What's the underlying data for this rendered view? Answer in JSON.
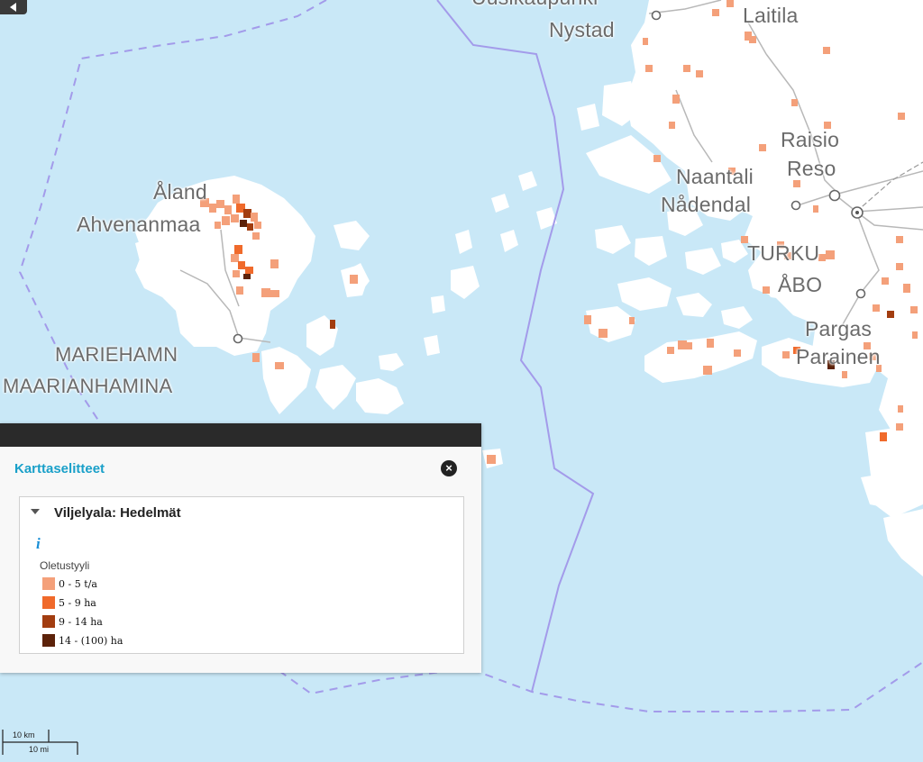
{
  "map": {
    "place_labels": [
      {
        "id": "uusikaupunki",
        "text": "Uusikaupunki"
      },
      {
        "id": "nystad",
        "text": "Nystad"
      },
      {
        "id": "laitila",
        "text": "Laitila"
      },
      {
        "id": "raisio",
        "text": "Raisio"
      },
      {
        "id": "reso",
        "text": "Reso"
      },
      {
        "id": "naantali",
        "text": "Naantali"
      },
      {
        "id": "nadendal",
        "text": "Nådendal"
      },
      {
        "id": "turku",
        "text": "TURKU"
      },
      {
        "id": "abo",
        "text": "ÅBO"
      },
      {
        "id": "pargas",
        "text": "Pargas"
      },
      {
        "id": "parainen",
        "text": "Parainen"
      },
      {
        "id": "aland",
        "text": "Åland"
      },
      {
        "id": "ahvenanmaa",
        "text": "Ahvenanmaa"
      },
      {
        "id": "mariehamn",
        "text": "MARIEHAMN"
      },
      {
        "id": "maarianhamina",
        "text": "MAARIANHAMINA"
      }
    ],
    "colors": {
      "water": "#c9e8f7",
      "land": "#ffffff",
      "boundary": "#a39bea",
      "class_1": "#f4a07a",
      "class_2": "#f06a2b",
      "class_3": "#a23d10",
      "class_4": "#5c220a"
    }
  },
  "legend_panel": {
    "title": "Karttaselitteet",
    "close_icon": "close-circle-icon",
    "layer": {
      "name": "Viljelyala: Hedelmät",
      "info_icon": "i",
      "style_name": "Oletustyyli",
      "items": [
        {
          "label": "0 - 5 t/a",
          "color": "#f4a07a"
        },
        {
          "label": "5 - 9 ha",
          "color": "#f06a2b"
        },
        {
          "label": "9 - 14 ha",
          "color": "#a23d10"
        },
        {
          "label": "14 - (100) ha",
          "color": "#5c220a"
        }
      ]
    }
  },
  "scale_bar": {
    "km_label": "10 km",
    "mi_label": "10 mi"
  }
}
